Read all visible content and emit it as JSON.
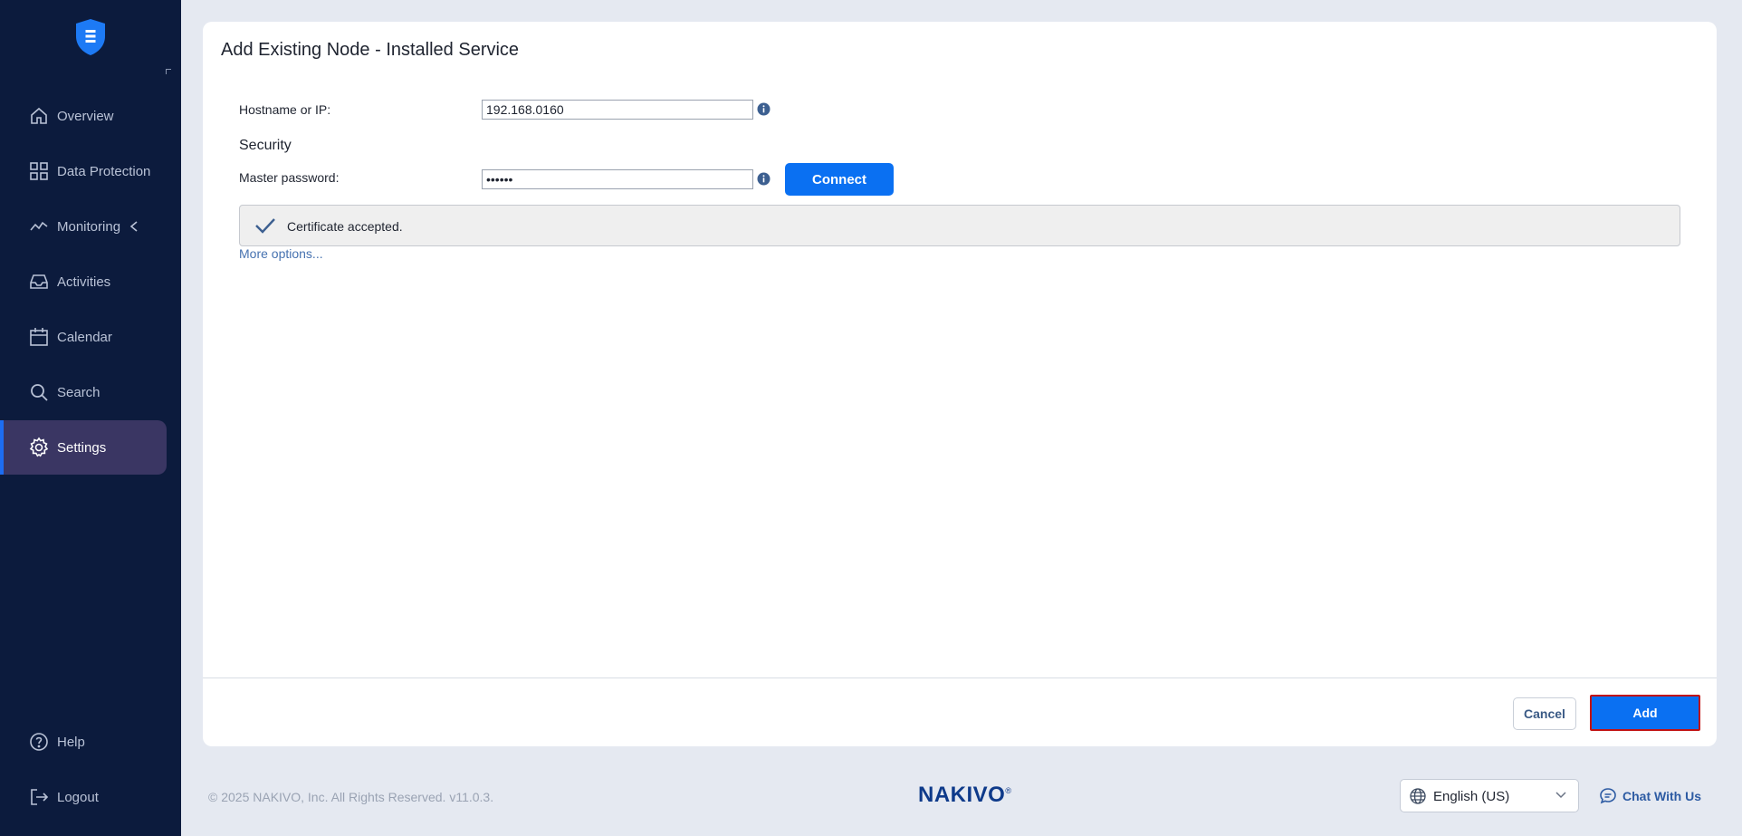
{
  "sidebar": {
    "items": [
      {
        "label": "Overview",
        "icon": "home-icon"
      },
      {
        "label": "Data Protection",
        "icon": "grid-icon"
      },
      {
        "label": "Monitoring",
        "icon": "activity-line-icon"
      },
      {
        "label": "Activities",
        "icon": "inbox-icon"
      },
      {
        "label": "Calendar",
        "icon": "calendar-icon"
      },
      {
        "label": "Search",
        "icon": "search-icon"
      },
      {
        "label": "Settings",
        "icon": "gear-icon",
        "active": true
      }
    ],
    "bottom": [
      {
        "label": "Help",
        "icon": "help-circle-icon"
      },
      {
        "label": "Logout",
        "icon": "logout-icon"
      }
    ]
  },
  "dialog": {
    "title": "Add Existing Node - Installed Service",
    "hostname_label": "Hostname or IP:",
    "hostname_value": "192.168.0160",
    "security_title": "Security",
    "password_label": "Master password:",
    "password_value": "••••••",
    "connect_label": "Connect",
    "certificate_message": "Certificate accepted.",
    "more_options": "More options...",
    "cancel_label": "Cancel",
    "add_label": "Add"
  },
  "footer": {
    "copyright": "© 2025 NAKIVO, Inc. All Rights Reserved. v11.0.3.",
    "brand": "NAKIVO",
    "brand_mark": "®",
    "language": "English (US)",
    "chat": "Chat With Us"
  },
  "colors": {
    "sidebar_bg": "#0c1b3d",
    "active_item_bg": "#3a3663",
    "accent": "#0a70f2",
    "highlight_border": "#c21111"
  }
}
